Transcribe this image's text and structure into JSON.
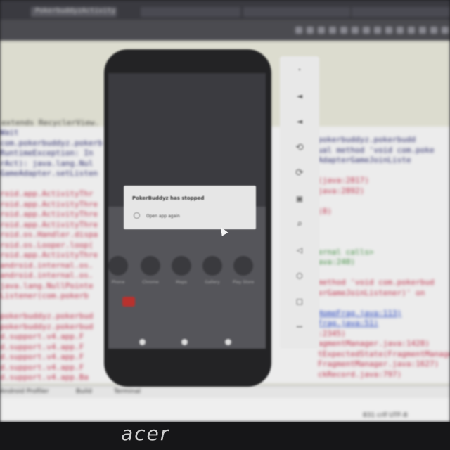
{
  "ide": {
    "tabs": [
      "PokerbuddyzActivity",
      "",
      "",
      ""
    ],
    "editor_label": "extends RecyclerView.",
    "log_lines_left": [
      "Wait",
      "com.pokerbuddyz.pokerb",
      "RuntimeException: In",
      "rAct): java.lang.Nul",
      "GameAdapter.setListen",
      "",
      "roid.app.ActivityThr",
      "roid.app.ActivityThre",
      "roid.app.ActivityThre",
      "roid.app.ActivityThre",
      "roid.os.Handler.dispa",
      "roid.os.Looper.loop(",
      "roid.app.ActivityThre",
      "android.internal.os.",
      "android.internal.os.",
      "java.lang.NullPointe",
      "Listener(com.pokerb",
      "",
      "pokerbuddyz.pokerbud",
      "pokerbuddyz.pokerbud",
      "d.support.v4.app.F",
      "d.support.v4.app.F",
      "d.support.v4.app.F",
      "d.support.v4.app.F",
      "d.support.v4.app.Ba"
    ],
    "log_lines_right": [
      "pokerbuddyz.pokerbudd",
      "ual method 'void com.poke",
      "AdapterGameJoinListe",
      "",
      "(java:2817)",
      "java:2892)",
      "",
      "(8)",
      "",
      "",
      "",
      "ernal calls>",
      "ava:240)",
      "",
      "method 'void com.pokerbud",
      "erGameJoinListener)' on",
      "",
      "HomeFrag.java:113)",
      "Frag.java:51)",
      ":2345)",
      "agmentManager.java:1428)",
      "tExpectedState(FragmentManager.java:",
      "FragmentManager.java:1627)",
      "ckRecord.java:797)"
    ],
    "status_items": [
      "Android Profiler",
      "Build",
      "Terminal"
    ],
    "bottom_right": "831 crlf UTF-8"
  },
  "emulator": {
    "toolbar_icons": [
      "more-icon",
      "volume-up-icon",
      "volume-down-icon",
      "rotate-left-icon",
      "rotate-right-icon",
      "camera-icon",
      "zoom-icon",
      "back-icon",
      "home-icon",
      "overview-icon",
      "more-options-icon"
    ],
    "apps": [
      "Phone",
      "Chrome",
      "Maps",
      "Gallery",
      "Play Store"
    ],
    "dialog": {
      "title": "PokerBuddyz has stopped",
      "option": "Open app again"
    }
  },
  "laptop": {
    "brand": "acer"
  }
}
